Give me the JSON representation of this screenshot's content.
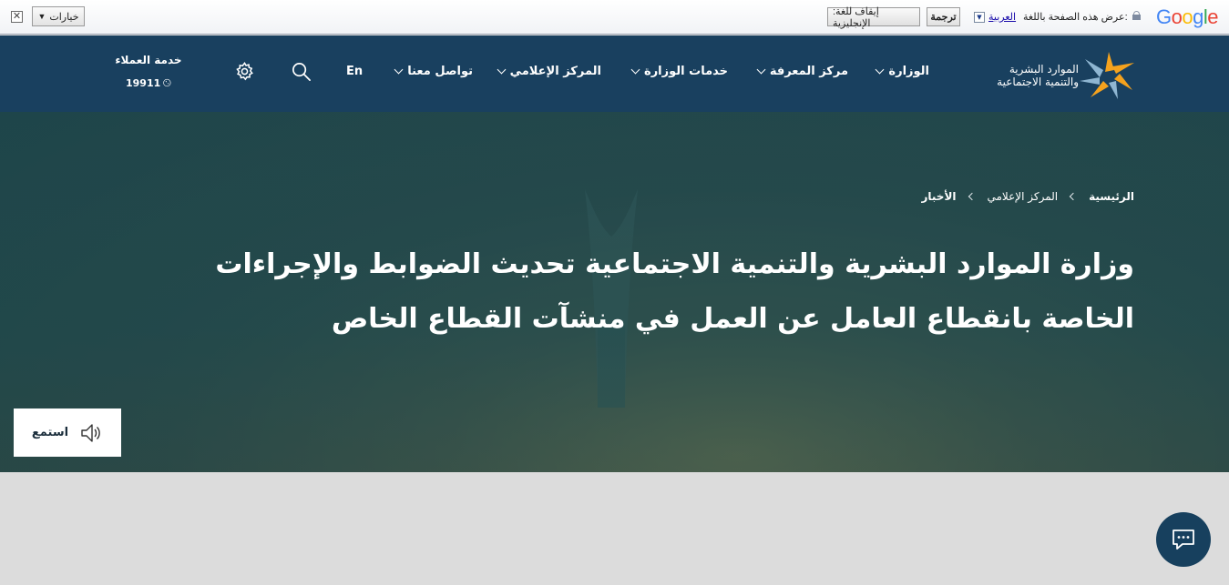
{
  "translate_bar": {
    "close_glyph": "✕",
    "options_label": "خيارات",
    "options_arrow": "▼",
    "logo": "Google",
    "view_page_in": "عرض هذه الصفحة باللغة:",
    "language": "العربية",
    "translate_button": "ترجمة",
    "turn_off_button": "إيقاف للغة: الإنجليزية"
  },
  "header": {
    "logo_line1": "الموارد البشرية",
    "logo_line2": "والتنمية الاجتماعية",
    "nav": [
      "الوزارة",
      "مركز المعرفة",
      "خدمات الوزارة",
      "المركز الإعلامي",
      "تواصل معنا"
    ],
    "lang_toggle": "En",
    "customer_service_title": "خدمة العملاء",
    "customer_service_number": "19911"
  },
  "breadcrumb": [
    "الرئيسية",
    "المركز الإعلامي",
    "الأخبار"
  ],
  "headline": "وزارة الموارد البشرية والتنمية الاجتماعية تحديث الضوابط والإجراءات الخاصة بانقطاع العامل عن العمل في منشآت القطاع الخاص",
  "listen_button": "استمع",
  "colors": {
    "header_bg": "#19405f",
    "accent_orange": "#f5a21d",
    "chat_bg": "#17405e"
  },
  "icons": [
    "close-icon",
    "dropdown-arrow-icon",
    "lock-icon",
    "ministry-logo-icon",
    "chevron-down-icon",
    "search-icon",
    "gear-icon",
    "phone-icon",
    "breadcrumb-chevron-icon",
    "speaker-icon",
    "chat-icon"
  ]
}
